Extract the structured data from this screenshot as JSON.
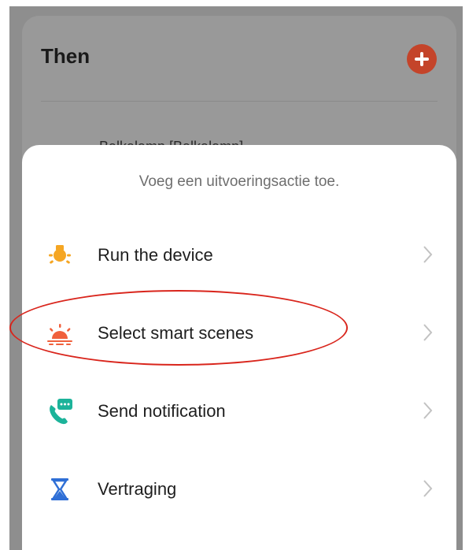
{
  "background": {
    "title": "Then",
    "peek_text": "Balkalamp [Balkalamp]"
  },
  "sheet": {
    "title": "Voeg een uitvoeringsactie toe.",
    "items": [
      {
        "label": "Run the device",
        "icon": "bulb-icon"
      },
      {
        "label": "Select smart scenes",
        "icon": "sunrise-icon"
      },
      {
        "label": "Send notification",
        "icon": "phone-message-icon"
      },
      {
        "label": "Vertraging",
        "icon": "hourglass-icon"
      }
    ]
  },
  "colors": {
    "accent_add": "#c4442a",
    "bulb": "#f5a623",
    "sunrise": "#f0603c",
    "phone": "#1cb39a",
    "hourglass": "#2f6fd6",
    "highlight": "#d9251c"
  }
}
